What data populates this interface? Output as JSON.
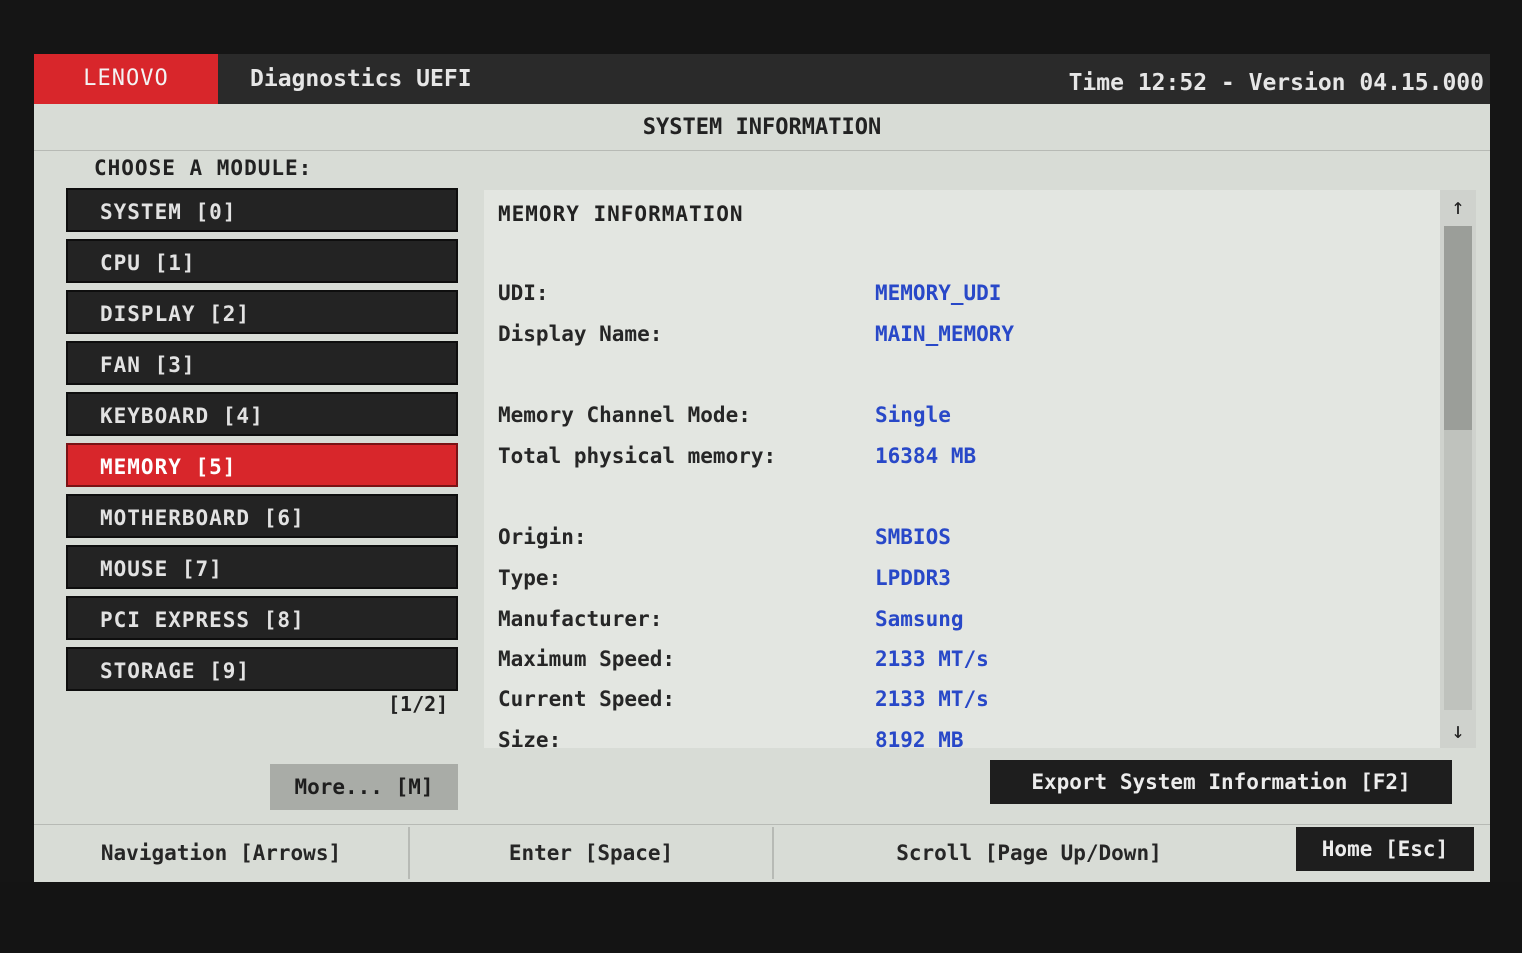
{
  "topbar": {
    "brand": "LENOVO",
    "app_title": "Diagnostics UEFI",
    "version_text": "Time 12:52 - Version 04.15.000"
  },
  "section_title": "SYSTEM INFORMATION",
  "sidebar": {
    "choose_label": "CHOOSE A MODULE:",
    "modules": [
      {
        "label": "SYSTEM [0]",
        "active": false
      },
      {
        "label": "CPU [1]",
        "active": false
      },
      {
        "label": "DISPLAY [2]",
        "active": false
      },
      {
        "label": "FAN [3]",
        "active": false
      },
      {
        "label": "KEYBOARD [4]",
        "active": false
      },
      {
        "label": "MEMORY [5]",
        "active": true
      },
      {
        "label": "MOTHERBOARD [6]",
        "active": false
      },
      {
        "label": "MOUSE [7]",
        "active": false
      },
      {
        "label": "PCI EXPRESS [8]",
        "active": false
      },
      {
        "label": "STORAGE [9]",
        "active": false
      }
    ],
    "page_indicator": "[1/2]",
    "more_label": "More... [M]"
  },
  "info": {
    "title": "MEMORY INFORMATION",
    "rows": [
      {
        "label": "UDI:",
        "value": "MEMORY_UDI"
      },
      {
        "label": "Display Name:",
        "value": "MAIN_MEMORY"
      },
      {
        "label": "Memory Channel Mode:",
        "value": "Single"
      },
      {
        "label": "Total physical memory:",
        "value": "16384 MB"
      },
      {
        "label": "Origin:",
        "value": "SMBIOS"
      },
      {
        "label": "Type:",
        "value": "LPDDR3"
      },
      {
        "label": "Manufacturer:",
        "value": "Samsung"
      },
      {
        "label": "Maximum Speed:",
        "value": "2133 MT/s"
      },
      {
        "label": "Current Speed:",
        "value": "2133 MT/s"
      },
      {
        "label": "Size:",
        "value": "8192 MB"
      }
    ],
    "scroll_up_icon": "arrow-up-icon",
    "scroll_down_icon": "arrow-down-icon"
  },
  "export_label": "Export System Information [F2]",
  "footer": {
    "navigation": "Navigation [Arrows]",
    "enter": "Enter [Space]",
    "scroll": "Scroll [Page Up/Down]",
    "home": "Home [Esc]"
  },
  "colors": {
    "accent_red": "#d8262b",
    "value_blue": "#2848c8",
    "dark_button": "#232323"
  }
}
